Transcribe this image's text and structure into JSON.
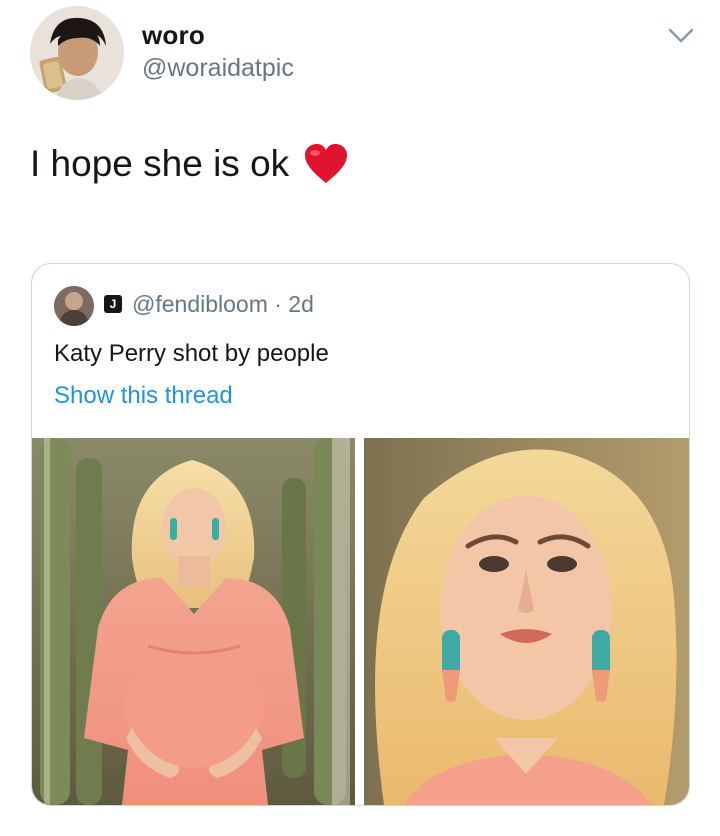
{
  "author": {
    "display_name": "woro",
    "handle": "@woraidatpic"
  },
  "tweet": {
    "text": "I hope she is ok",
    "emoji": "heart-icon"
  },
  "quoted_tweet": {
    "badge": "J",
    "meta": "@fendibloom · 2d",
    "text": "Katy Perry shot by people",
    "thread_link": "Show this thread",
    "photos": [
      "pregnant-woman-pink-dress-cactus-photo",
      "woman-portrait-blonde-earrings-photo"
    ]
  },
  "colors": {
    "link": "#1b95e0",
    "secondary_text": "#657786",
    "border": "#ccd6dd",
    "heart": "#e0142f"
  }
}
